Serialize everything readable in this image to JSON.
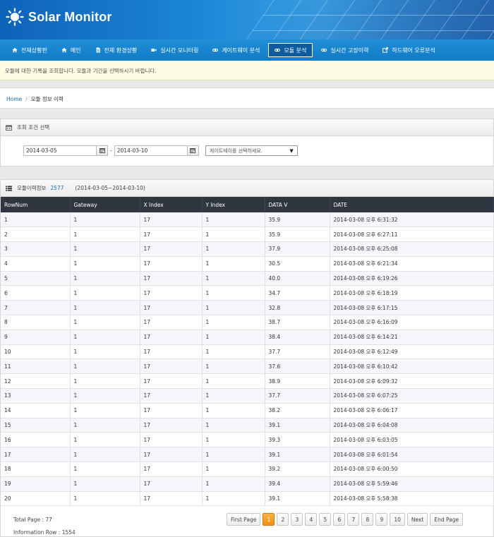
{
  "app": {
    "title": "Solar Monitor"
  },
  "nav": [
    {
      "label": "전체상황판",
      "icon": "home-icon"
    },
    {
      "label": "메인",
      "icon": "home-icon"
    },
    {
      "label": "전체 환경상황",
      "icon": "document-icon"
    },
    {
      "label": "실시간 모니터링",
      "icon": "video-icon"
    },
    {
      "label": "게이트웨이 분석",
      "icon": "link-icon"
    },
    {
      "label": "모듈 분석",
      "icon": "link-icon",
      "active": true
    },
    {
      "label": "실시간 고장이력",
      "icon": "link-icon"
    },
    {
      "label": "하드웨어 오류분석",
      "icon": "external-icon"
    }
  ],
  "notice": "모듈에 대한 기록을 조회합니다. 모듈과 기간을 선택하시기 바랍니다.",
  "breadcrumb": {
    "home": "Home",
    "current": "모듈 정보 이력"
  },
  "filter": {
    "title": "조회 조건 선택",
    "start_date": "2014-03-05",
    "end_date": "2014-03-10",
    "separator": "-",
    "gateway_select": "게이트웨이를 선택하세요."
  },
  "result": {
    "title": "모듈이력정보",
    "count": "2577",
    "range": "(2014-03-05~2014-03-10)"
  },
  "table": {
    "columns": [
      "RowNum",
      "Gateway",
      "X Index",
      "Y Index",
      "DATA V",
      "DATE"
    ],
    "rows": [
      [
        "1",
        "1",
        "17",
        "1",
        "35.9",
        "2014-03-08 오후 6:31:32"
      ],
      [
        "2",
        "1",
        "17",
        "1",
        "35.9",
        "2014-03-08 오후 6:27:11"
      ],
      [
        "3",
        "1",
        "17",
        "1",
        "37.9",
        "2014-03-08 오후 6:25:08"
      ],
      [
        "4",
        "1",
        "17",
        "1",
        "30.5",
        "2014-03-08 오후 6:21:34"
      ],
      [
        "5",
        "1",
        "17",
        "1",
        "40.0",
        "2014-03-08 오후 6:19:26"
      ],
      [
        "6",
        "1",
        "17",
        "1",
        "34.7",
        "2014-03-08 오후 6:18:19"
      ],
      [
        "7",
        "1",
        "17",
        "1",
        "32.8",
        "2014-03-08 오후 6:17:15"
      ],
      [
        "8",
        "1",
        "17",
        "1",
        "38.7",
        "2014-03-08 오후 6:16:09"
      ],
      [
        "9",
        "1",
        "17",
        "1",
        "38.4",
        "2014-03-08 오후 6:14:21"
      ],
      [
        "10",
        "1",
        "17",
        "1",
        "37.7",
        "2014-03-08 오후 6:12:49"
      ],
      [
        "11",
        "1",
        "17",
        "1",
        "37.6",
        "2014-03-08 오후 6:10:42"
      ],
      [
        "12",
        "1",
        "17",
        "1",
        "38.9",
        "2014-03-08 오후 6:09:32"
      ],
      [
        "13",
        "1",
        "17",
        "1",
        "37.7",
        "2014-03-08 오후 6:07:25"
      ],
      [
        "14",
        "1",
        "17",
        "1",
        "38.2",
        "2014-03-08 오후 6:06:17"
      ],
      [
        "15",
        "1",
        "17",
        "1",
        "39.1",
        "2014-03-08 오후 6:04:08"
      ],
      [
        "16",
        "1",
        "17",
        "1",
        "39.3",
        "2014-03-08 오후 6:03:05"
      ],
      [
        "17",
        "1",
        "17",
        "1",
        "39.1",
        "2014-03-08 오후 6:01:54"
      ],
      [
        "18",
        "1",
        "17",
        "1",
        "39.2",
        "2014-03-08 오후 6:00:50"
      ],
      [
        "19",
        "1",
        "17",
        "1",
        "39.4",
        "2014-03-08 오후 5:59:46"
      ],
      [
        "20",
        "1",
        "17",
        "1",
        "39.1",
        "2014-03-08 오후 5:58:38"
      ]
    ]
  },
  "footer": {
    "total_page": "Total Page : 77",
    "information_row": "Information Row : 1554"
  },
  "pager": {
    "first": "First Page",
    "pages": [
      "1",
      "2",
      "3",
      "4",
      "5",
      "6",
      "7",
      "8",
      "9",
      "10"
    ],
    "active_page": "1",
    "next": "Next",
    "end": "End Page"
  },
  "colors": {
    "header_blue": "#1c86d6",
    "nav_blue": "#127bc4",
    "table_head": "#2f3640",
    "pager_active": "#ef8f0f",
    "link": "#1a6fb5"
  }
}
